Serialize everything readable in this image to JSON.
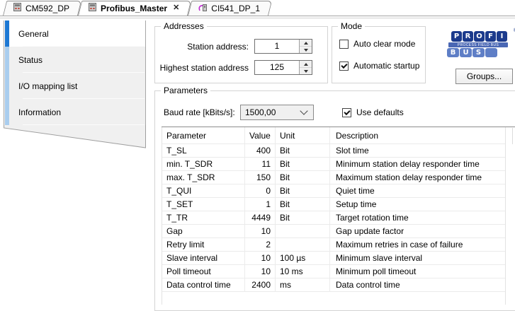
{
  "doc_tabs": [
    {
      "label": "CM592_DP"
    },
    {
      "label": "Profibus_Master",
      "close_glyph": "✕"
    },
    {
      "label": "CI541_DP_1"
    }
  ],
  "sidebar": {
    "items": [
      {
        "label": "General"
      },
      {
        "label": "Status"
      },
      {
        "label": "I/O mapping list"
      },
      {
        "label": "Information"
      }
    ],
    "active_index": 0
  },
  "addresses": {
    "legend": "Addresses",
    "station_label": "Station address:",
    "station_value": "1",
    "highest_label": "Highest station address",
    "highest_value": "125"
  },
  "mode": {
    "legend": "Mode",
    "auto_clear_label": "Auto clear mode",
    "auto_clear_checked": false,
    "auto_startup_label": "Automatic startup",
    "auto_startup_checked": true
  },
  "logo": {
    "top_letters": [
      "P",
      "R",
      "O",
      "F",
      "I"
    ],
    "registered": "®",
    "band_text": "PROCESS FIELD BUS",
    "bottom_letters": [
      "B",
      "U",
      "S",
      ""
    ],
    "dark_blue": "#1b3a8c",
    "light_blue": "#5e7ec6"
  },
  "groups_button_label": "Groups...",
  "parameters": {
    "legend": "Parameters",
    "baud_label": "Baud rate [kBits/s]:",
    "baud_value": "1500,00",
    "use_defaults_label": "Use defaults",
    "use_defaults_checked": true,
    "table": {
      "columns": [
        "Parameter",
        "Value",
        "Unit",
        "Description"
      ],
      "rows": [
        [
          "T_SL",
          "400",
          "Bit",
          "Slot time"
        ],
        [
          "min. T_SDR",
          "11",
          "Bit",
          "Minimum station delay responder time"
        ],
        [
          "max. T_SDR",
          "150",
          "Bit",
          "Maximum station delay responder time"
        ],
        [
          "T_QUI",
          "0",
          "Bit",
          "Quiet time"
        ],
        [
          "T_SET",
          "1",
          "Bit",
          "Setup time"
        ],
        [
          "T_TR",
          "4449",
          "Bit",
          "Target rotation time"
        ],
        [
          "Gap",
          "10",
          "",
          "Gap update factor"
        ],
        [
          "Retry limit",
          "2",
          "",
          "Maximum retries in case of failure"
        ],
        [
          "Slave interval",
          "10",
          "100 µs",
          "Minimum slave interval"
        ],
        [
          "Poll timeout",
          "10",
          "10 ms",
          "Minimum poll timeout"
        ],
        [
          "Data control time",
          "2400",
          "ms",
          "Data control time"
        ]
      ]
    }
  },
  "colors": {
    "active_sidebar_accent": "#1d78d3",
    "inactive_sidebar_accent": "#a9cdee"
  }
}
